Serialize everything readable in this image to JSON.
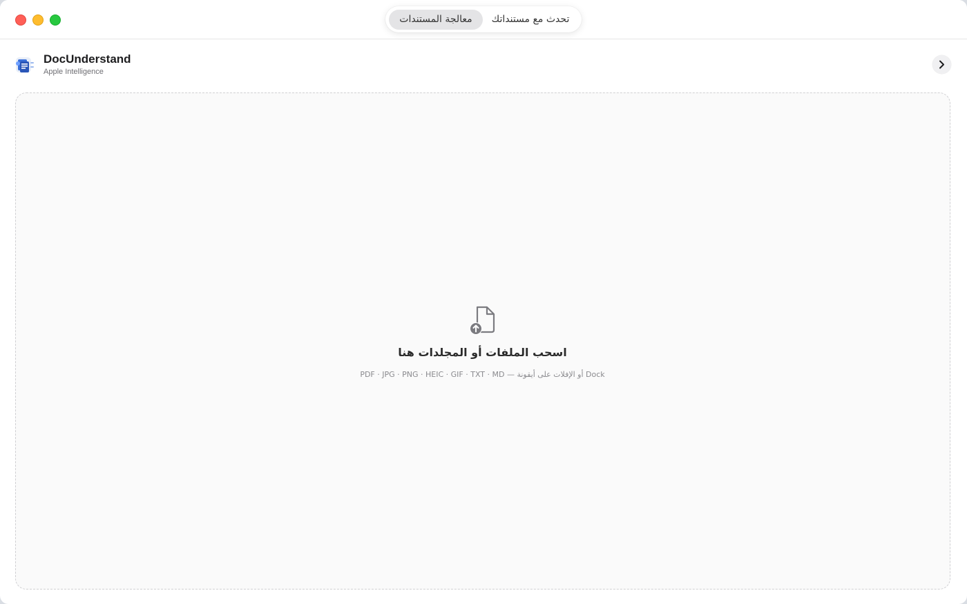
{
  "window": {
    "tabs": [
      {
        "label": "معالجة المستندات",
        "active": true
      },
      {
        "label": "تحدث مع مستنداتك",
        "active": false
      }
    ]
  },
  "header": {
    "app_name": "DocUnderstand",
    "app_subtitle": "Apple Intelligence"
  },
  "dropzone": {
    "title": "اسحب الملفات أو المجلدات هنا",
    "formats": "PDF · JPG · PNG · HEIC · GIF · TXT · MD — أو الإفلات على أيقونة Dock",
    "icon": "document-upload-icon"
  },
  "colors": {
    "close": "#ff5f57",
    "minimize": "#febc2e",
    "maximize": "#28c840"
  }
}
